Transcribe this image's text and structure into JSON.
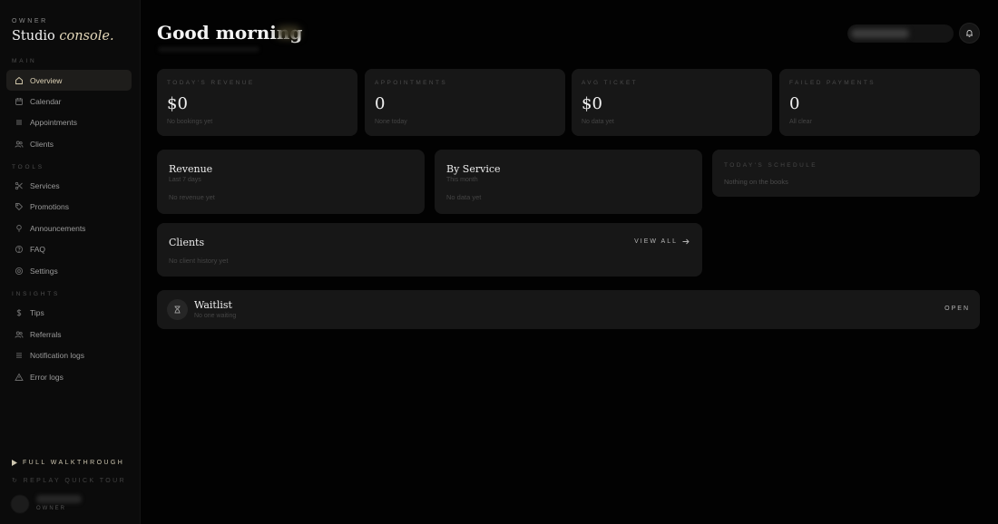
{
  "sidebar": {
    "owner_label": "OWNER",
    "brand_main": "Studio",
    "brand_accent": "console.",
    "sections": {
      "main": "MAIN",
      "tools": "TOOLS",
      "insights": "INSIGHTS"
    },
    "items": [
      {
        "label": "Overview",
        "icon": "house-icon",
        "active": true
      },
      {
        "label": "Calendar",
        "icon": "calendar-icon"
      },
      {
        "label": "Appointments",
        "icon": "list-icon"
      },
      {
        "label": "Clients",
        "icon": "users-icon"
      },
      {
        "label": "Services",
        "icon": "scissors-icon"
      },
      {
        "label": "Promotions",
        "icon": "tag-icon"
      },
      {
        "label": "Announcements",
        "icon": "megaphone-icon"
      },
      {
        "label": "FAQ",
        "icon": "help-circle-icon"
      },
      {
        "label": "Settings",
        "icon": "gear-icon"
      },
      {
        "label": "Tips",
        "icon": "dollar-icon"
      },
      {
        "label": "Referrals",
        "icon": "users-icon"
      },
      {
        "label": "Notification logs",
        "icon": "lines-icon"
      },
      {
        "label": "Error logs",
        "icon": "warning-icon"
      }
    ],
    "walkthrough": "FULL WALKTHROUGH",
    "replay": "REPLAY QUICK TOUR",
    "user_role": "OWNER"
  },
  "header": {
    "greeting": "Good morning"
  },
  "kpis": [
    {
      "label": "TODAY'S REVENUE",
      "value": "$0",
      "sub": "No bookings yet"
    },
    {
      "label": "APPOINTMENTS",
      "value": "0",
      "sub": "None today"
    },
    {
      "label": "AVG TICKET",
      "value": "$0",
      "sub": "No data yet"
    },
    {
      "label": "FAILED PAYMENTS",
      "value": "0",
      "sub": "All clear"
    }
  ],
  "revenue": {
    "title": "Revenue",
    "sub": "Last 7 days",
    "empty": "No revenue yet"
  },
  "by_service": {
    "title": "By Service",
    "sub": "This month",
    "empty": "No data yet"
  },
  "schedule": {
    "label": "TODAY'S SCHEDULE",
    "empty": "Nothing on the books"
  },
  "clients": {
    "title": "Clients",
    "view_all": "VIEW ALL",
    "empty": "No client history yet"
  },
  "waitlist": {
    "title": "Waitlist",
    "sub": "No one waiting",
    "open": "OPEN"
  },
  "colors": {
    "background": "#020202",
    "card": "#171717",
    "accent": "#e4d8ba",
    "sidebar": "#0b0b0b"
  }
}
